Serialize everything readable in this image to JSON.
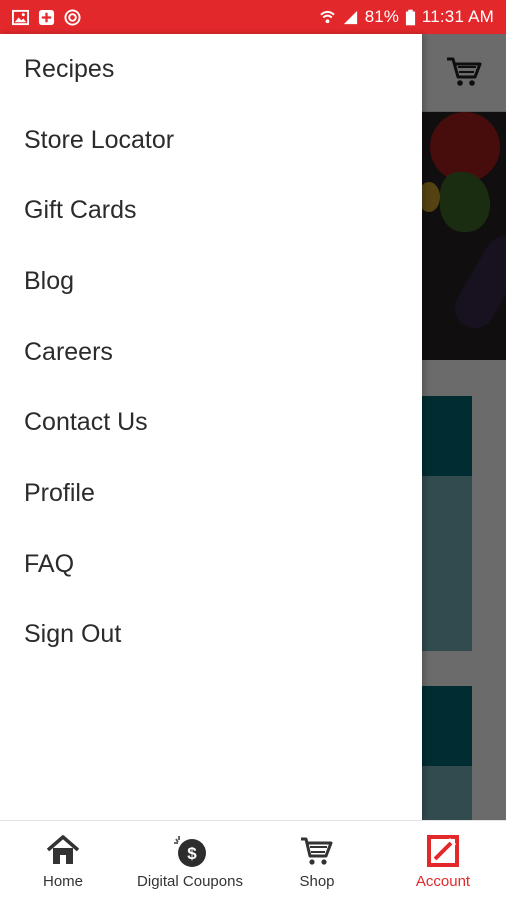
{
  "status_bar": {
    "battery": "81%",
    "time": "11:31 AM",
    "icons": [
      "image-icon",
      "app-notification-icon",
      "target-icon",
      "wifi-icon",
      "signal-icon",
      "battery-icon"
    ]
  },
  "colors": {
    "brand_red": "#e3282b",
    "teal_dark": "#006b75",
    "teal_light": "#76b2bd"
  },
  "drawer": {
    "items": [
      {
        "label": "Recipes"
      },
      {
        "label": "Store Locator"
      },
      {
        "label": "Gift Cards"
      },
      {
        "label": "Blog"
      },
      {
        "label": "Careers"
      },
      {
        "label": "Contact Us"
      },
      {
        "label": "Profile"
      },
      {
        "label": "FAQ"
      },
      {
        "label": "Sign Out"
      }
    ]
  },
  "header": {
    "icon": "cart-icon"
  },
  "bottom_nav": {
    "items": [
      {
        "label": "Home",
        "icon": "home-icon"
      },
      {
        "label": "Digital Coupons",
        "icon": "dollar-coin-icon"
      },
      {
        "label": "Shop",
        "icon": "cart-icon"
      },
      {
        "label": "Account",
        "icon": "account-icon",
        "active": true
      }
    ]
  }
}
